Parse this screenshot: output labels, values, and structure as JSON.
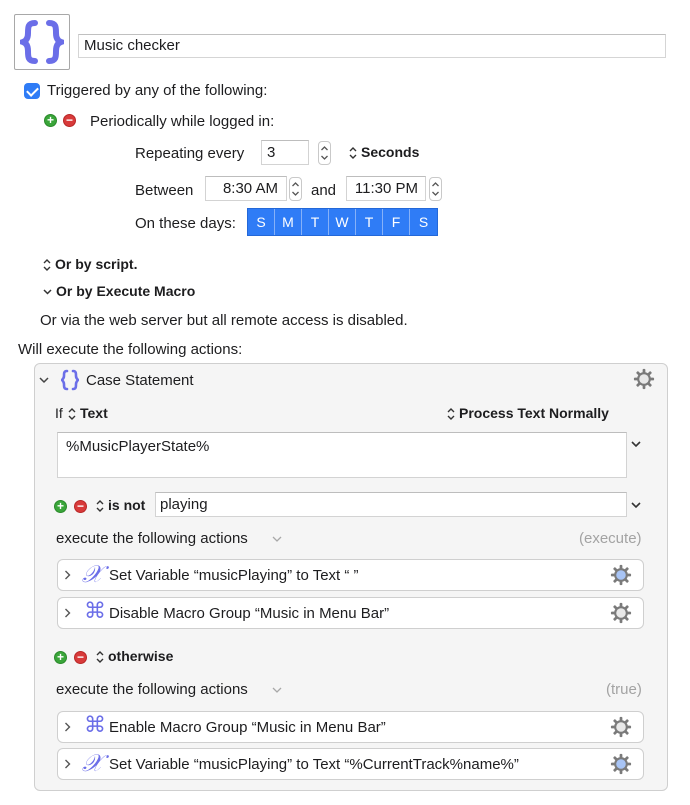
{
  "macro": {
    "name": "Music checker",
    "icon": "curly-braces-icon"
  },
  "trigger": {
    "header": "Triggered by any of the following:",
    "periodic": {
      "label": "Periodically while logged in:",
      "repeat_label": "Repeating every",
      "repeat_value": "3",
      "unit": "Seconds",
      "between_label": "Between",
      "start_time": "8:30 AM",
      "and_label": "and",
      "end_time": "11:30 PM",
      "days_label": "On these days:",
      "days": [
        "S",
        "M",
        "T",
        "W",
        "T",
        "F",
        "S"
      ]
    },
    "by_script": "Or by script.",
    "by_execute": "Or by Execute Macro",
    "web_server": "Or via the web server but all remote access is disabled."
  },
  "will_execute": "Will execute the following actions:",
  "case_statement": {
    "title": "Case Statement",
    "if_label": "If",
    "source": "Text",
    "processing": "Process Text Normally",
    "text_value": "%MusicPlayerState%",
    "case1": {
      "condition": "is not",
      "value": "playing",
      "execute_label": "execute the following actions",
      "execute_status": "(execute)",
      "actions": [
        {
          "icon": "variable-x-icon",
          "label": "Set Variable “musicPlaying” to Text “ ”"
        },
        {
          "icon": "command-key-icon",
          "label": "Disable Macro Group “Music in Menu Bar”"
        }
      ]
    },
    "otherwise": {
      "condition": "otherwise",
      "execute_label": "execute the following actions",
      "execute_status": "(true)",
      "actions": [
        {
          "icon": "command-key-icon",
          "label": "Enable Macro Group “Music in Menu Bar”"
        },
        {
          "icon": "variable-x-icon",
          "label": "Set Variable “musicPlaying” to Text “%CurrentTrack%name%”"
        }
      ]
    }
  },
  "colors": {
    "accent": "#2f7cf6",
    "icon_purple": "#6b6ee8",
    "add": "#3aa53a",
    "remove": "#d83a3a"
  }
}
